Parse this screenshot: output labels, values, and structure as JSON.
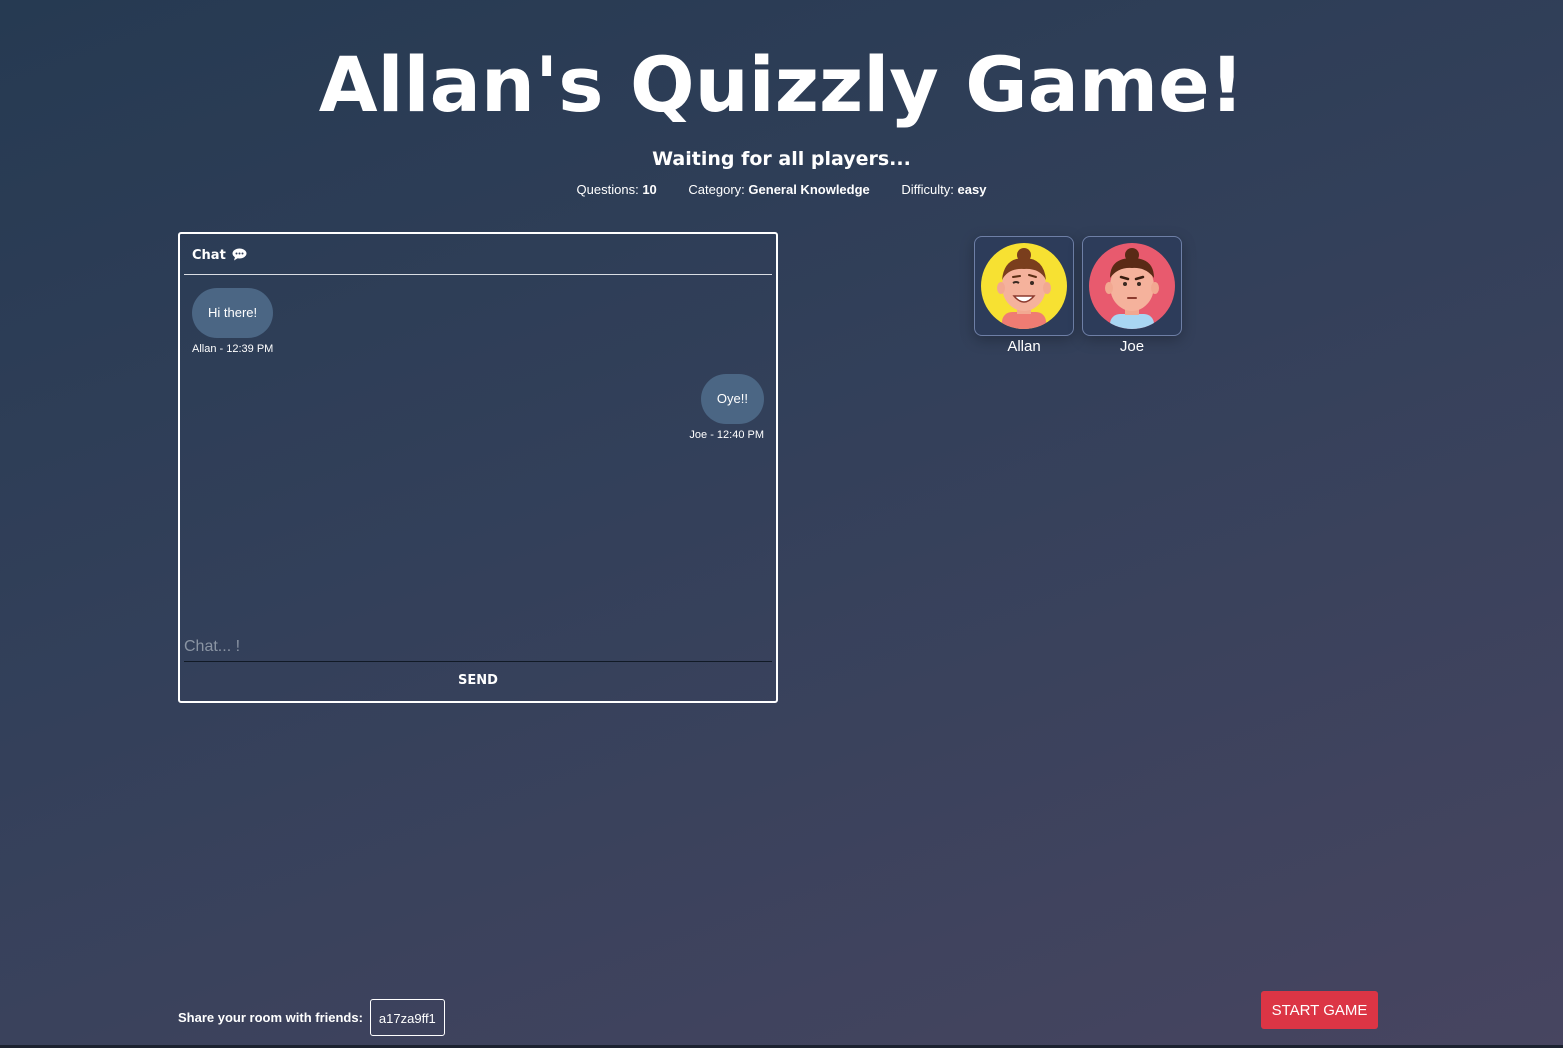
{
  "header": {
    "title": "Allan's Quizzly Game!",
    "status": "Waiting for all players...",
    "meta": [
      {
        "label": "Questions:",
        "value": "10"
      },
      {
        "label": "Category:",
        "value": "General Knowledge"
      },
      {
        "label": "Difficulty:",
        "value": "easy"
      }
    ]
  },
  "chat": {
    "title": "Chat",
    "title_icon": "speech-bubble-icon",
    "messages": [
      {
        "text": "Hi there!",
        "author_time": "Allan - 12:39 PM",
        "side": "left"
      },
      {
        "text": "Oye!!",
        "author_time": "Joe - 12:40 PM",
        "side": "right"
      }
    ],
    "input_placeholder": "Chat... !",
    "send_label": "SEND"
  },
  "players": [
    {
      "name": "Allan",
      "avatar": "avatar-allan-icon",
      "avatar_bg": "#f7e132"
    },
    {
      "name": "Joe",
      "avatar": "avatar-joe-icon",
      "avatar_bg": "#e85a6e"
    }
  ],
  "footer": {
    "share_label": "Share your room with friends:",
    "room_code": "a17za9ff1",
    "start_label": "START GAME"
  },
  "colors": {
    "accent_red": "#dc3545",
    "bubble": "#4b6684"
  }
}
